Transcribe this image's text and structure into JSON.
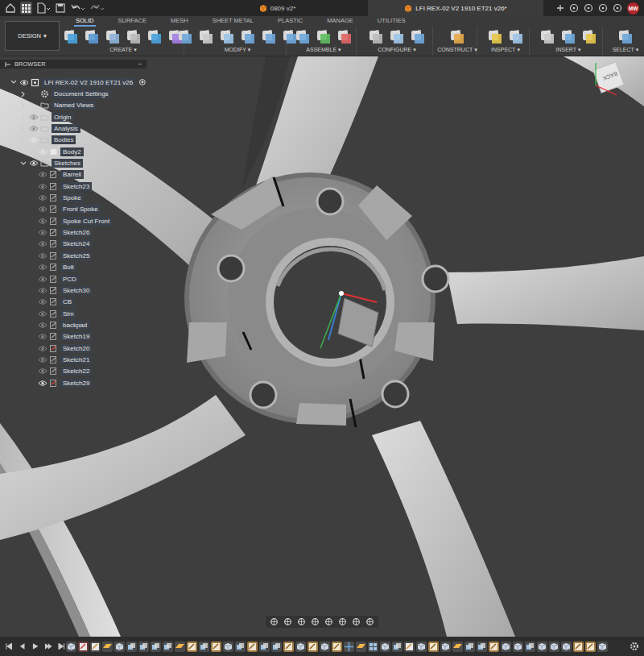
{
  "window": {
    "title": "LFI REX-02 V2 1910 ET21 v26*"
  },
  "app_tabs": [
    {
      "label": "0809 v2*",
      "selected": false
    },
    {
      "label": "LFI REX-02 V2 1910 ET21 v26*",
      "selected": true
    }
  ],
  "user": {
    "initials": "MW"
  },
  "workspace": {
    "label": "DESIGN",
    "arrow": "▾"
  },
  "toolbar_tabs": [
    {
      "label": "SOLID",
      "selected": true
    },
    {
      "label": "SURFACE",
      "selected": false
    },
    {
      "label": "MESH",
      "selected": false
    },
    {
      "label": "SHEET METAL",
      "selected": false
    },
    {
      "label": "PLASTIC",
      "selected": false
    },
    {
      "label": "MANAGE",
      "selected": false
    },
    {
      "label": "UTILITIES",
      "selected": false
    }
  ],
  "toolbar_groups": [
    {
      "label": "CREATE",
      "arrow": "▾"
    },
    {
      "label": "MODIFY",
      "arrow": "▾"
    },
    {
      "label": "ASSEMBLE",
      "arrow": "▾"
    },
    {
      "label": "CONFIGURE",
      "arrow": "▾"
    },
    {
      "label": "CONSTRUCT",
      "arrow": "▾"
    },
    {
      "label": "INSPECT",
      "arrow": "▾"
    },
    {
      "label": "INSERT",
      "arrow": "▾"
    },
    {
      "label": "SELECT",
      "arrow": "▾"
    }
  ],
  "browser": {
    "title": "BROWSER",
    "collapse": "−",
    "items": [
      {
        "label": "LFI REX-02 V2 1910 ET21 v26",
        "depth": 0,
        "kind": "component",
        "has_children": true,
        "expanded": true,
        "has_eye": true,
        "visible": true,
        "color": "#e0e0e0"
      },
      {
        "label": "Document Settings",
        "depth": 1,
        "kind": "settings",
        "has_children": true,
        "expanded": false,
        "has_eye": false,
        "visible": false,
        "color": "#bdbdbd"
      },
      {
        "label": "Named Views",
        "depth": 1,
        "kind": "folder",
        "has_children": true,
        "expanded": false,
        "has_eye": false,
        "visible": false,
        "color": "#bdbdbd"
      },
      {
        "label": "Origin",
        "depth": 1,
        "kind": "folder",
        "has_children": true,
        "expanded": false,
        "has_eye": true,
        "visible": false,
        "color": "#bdbdbd"
      },
      {
        "label": "Analysis",
        "depth": 1,
        "kind": "folder",
        "has_children": true,
        "expanded": false,
        "has_eye": true,
        "visible": false,
        "color": "#bdbdbd"
      },
      {
        "label": "Bodies",
        "depth": 1,
        "kind": "folder",
        "has_children": true,
        "expanded": true,
        "has_eye": true,
        "visible": true,
        "color": "#bdbdbd"
      },
      {
        "label": "Body2",
        "depth": 2,
        "kind": "body",
        "has_children": false,
        "expanded": false,
        "has_eye": true,
        "visible": true,
        "color": "#e8e8e8"
      },
      {
        "label": "Sketches",
        "depth": 1,
        "kind": "folder",
        "has_children": true,
        "expanded": true,
        "has_eye": true,
        "visible": true,
        "color": "#bdbdbd"
      },
      {
        "label": "Barrell",
        "depth": 2,
        "kind": "sketch",
        "has_children": false,
        "expanded": false,
        "has_eye": true,
        "visible": false,
        "color": "#9a9a9a"
      },
      {
        "label": "Sketch23",
        "depth": 2,
        "kind": "sketch",
        "has_children": false,
        "expanded": false,
        "has_eye": true,
        "visible": false,
        "color": "#9a9a9a"
      },
      {
        "label": "Spoke",
        "depth": 2,
        "kind": "sketch",
        "has_children": false,
        "expanded": false,
        "has_eye": true,
        "visible": false,
        "color": "#9a9a9a"
      },
      {
        "label": "Front Spoke",
        "depth": 2,
        "kind": "sketch",
        "has_children": false,
        "expanded": false,
        "has_eye": true,
        "visible": false,
        "color": "#9a9a9a"
      },
      {
        "label": "Spoke Cut Front",
        "depth": 2,
        "kind": "sketch",
        "has_children": false,
        "expanded": false,
        "has_eye": true,
        "visible": false,
        "color": "#9a9a9a"
      },
      {
        "label": "Sketch26",
        "depth": 2,
        "kind": "sketch",
        "has_children": false,
        "expanded": false,
        "has_eye": true,
        "visible": false,
        "color": "#9a9a9a"
      },
      {
        "label": "Sketch24",
        "depth": 2,
        "kind": "sketch",
        "has_children": false,
        "expanded": false,
        "has_eye": true,
        "visible": false,
        "color": "#9a9a9a"
      },
      {
        "label": "Sketch25",
        "depth": 2,
        "kind": "sketch",
        "has_children": false,
        "expanded": false,
        "has_eye": true,
        "visible": false,
        "color": "#9a9a9a"
      },
      {
        "label": "Bolt",
        "depth": 2,
        "kind": "sketch",
        "has_children": false,
        "expanded": false,
        "has_eye": true,
        "visible": false,
        "color": "#9a9a9a"
      },
      {
        "label": "PCD",
        "depth": 2,
        "kind": "sketch",
        "has_children": false,
        "expanded": false,
        "has_eye": true,
        "visible": false,
        "color": "#9a9a9a"
      },
      {
        "label": "Sketch30",
        "depth": 2,
        "kind": "sketch",
        "has_children": false,
        "expanded": false,
        "has_eye": true,
        "visible": false,
        "color": "#9a9a9a"
      },
      {
        "label": "CB",
        "depth": 2,
        "kind": "sketch",
        "has_children": false,
        "expanded": false,
        "has_eye": true,
        "visible": false,
        "color": "#9a9a9a"
      },
      {
        "label": "Sim",
        "depth": 2,
        "kind": "sketch",
        "has_children": false,
        "expanded": false,
        "has_eye": true,
        "visible": false,
        "color": "#9a9a9a"
      },
      {
        "label": "backpad",
        "depth": 2,
        "kind": "sketch",
        "has_children": false,
        "expanded": false,
        "has_eye": true,
        "visible": false,
        "color": "#9a9a9a"
      },
      {
        "label": "Sketch19",
        "depth": 2,
        "kind": "sketch",
        "has_children": false,
        "expanded": false,
        "has_eye": true,
        "visible": false,
        "color": "#9a9a9a"
      },
      {
        "label": "Sketch20",
        "depth": 2,
        "kind": "sketch",
        "has_children": false,
        "expanded": false,
        "has_eye": true,
        "visible": false,
        "color": "#d0453a"
      },
      {
        "label": "Sketch21",
        "depth": 2,
        "kind": "sketch",
        "has_children": false,
        "expanded": false,
        "has_eye": true,
        "visible": false,
        "color": "#9a9a9a"
      },
      {
        "label": "Sketch22",
        "depth": 2,
        "kind": "sketch",
        "has_children": false,
        "expanded": false,
        "has_eye": true,
        "visible": false,
        "color": "#9a9a9a"
      },
      {
        "label": "Sketch29",
        "depth": 2,
        "kind": "sketch",
        "has_children": false,
        "expanded": false,
        "has_eye": true,
        "visible": true,
        "color": "#d0453a"
      }
    ]
  },
  "viewcube": {
    "face": "BACK"
  },
  "timeline": {
    "features": [
      {
        "kind": "extrude"
      },
      {
        "kind": "sketch_error"
      },
      {
        "kind": "sketch"
      },
      {
        "kind": "plane"
      },
      {
        "kind": "extrude"
      },
      {
        "kind": "combine"
      },
      {
        "kind": "combine"
      },
      {
        "kind": "combine"
      },
      {
        "kind": "combine"
      },
      {
        "kind": "plane"
      },
      {
        "kind": "sketch_active"
      },
      {
        "kind": "combine"
      },
      {
        "kind": "sketch_active"
      },
      {
        "kind": "extrude"
      },
      {
        "kind": "combine"
      },
      {
        "kind": "sketch_active"
      },
      {
        "kind": "combine"
      },
      {
        "kind": "combine"
      },
      {
        "kind": "sketch_active"
      },
      {
        "kind": "extrude"
      },
      {
        "kind": "sketch_active"
      },
      {
        "kind": "extrude"
      },
      {
        "kind": "sketch_active"
      },
      {
        "kind": "move"
      },
      {
        "kind": "plane"
      },
      {
        "kind": "pattern"
      },
      {
        "kind": "extrude"
      },
      {
        "kind": "combine"
      },
      {
        "kind": "sketch"
      },
      {
        "kind": "extrude"
      },
      {
        "kind": "sketch_active"
      },
      {
        "kind": "extrude"
      },
      {
        "kind": "plane"
      },
      {
        "kind": "combine"
      },
      {
        "kind": "combine"
      },
      {
        "kind": "sketch_active"
      },
      {
        "kind": "extrude"
      },
      {
        "kind": "extrude"
      },
      {
        "kind": "combine"
      },
      {
        "kind": "extrude"
      },
      {
        "kind": "extrude"
      },
      {
        "kind": "extrude"
      },
      {
        "kind": "sketch_active"
      },
      {
        "kind": "sketch_active"
      },
      {
        "kind": "extrude"
      }
    ]
  }
}
